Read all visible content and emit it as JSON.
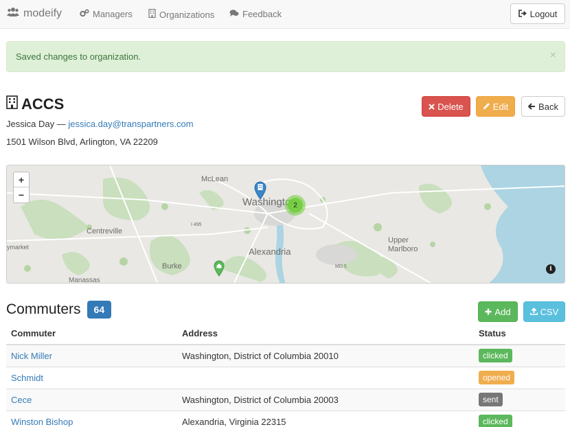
{
  "navbar": {
    "brand": "modeify",
    "items": [
      {
        "label": "Managers",
        "icon": "cogs-icon"
      },
      {
        "label": "Organizations",
        "icon": "building-icon"
      },
      {
        "label": "Feedback",
        "icon": "comments-icon"
      }
    ],
    "logout_label": "Logout"
  },
  "alert": {
    "message": "Saved changes to organization.",
    "close": "×"
  },
  "organization": {
    "name": "ACCS",
    "contact_name": "Jessica Day",
    "contact_separator": "—",
    "contact_email": "jessica.day@transpartners.com",
    "address": "1501 Wilson Blvd, Arlington, VA 22209"
  },
  "actions": {
    "delete_label": "Delete",
    "edit_label": "Edit",
    "back_label": "Back"
  },
  "map": {
    "zoom_in": "+",
    "zoom_out": "−",
    "cluster_count": "2",
    "info": "i",
    "places": {
      "mclean": "McLean",
      "washington": "Washington",
      "centreville": "Centreville",
      "alexandria": "Alexandria",
      "upper_marlboro": "Upper Marlboro",
      "burke": "Burke",
      "manassas": "Manassas",
      "market": "ymarket",
      "i495": "I 495",
      "md5": "MD 5"
    }
  },
  "commuters": {
    "title": "Commuters",
    "count": "64",
    "add_label": "Add",
    "csv_label": "CSV",
    "columns": [
      "Commuter",
      "Address",
      "Status"
    ],
    "rows": [
      {
        "name": "Nick Miller",
        "address": "Washington, District of Columbia 20010",
        "status": "clicked"
      },
      {
        "name": "Schmidt",
        "address": "",
        "status": "opened"
      },
      {
        "name": "Cece",
        "address": "Washington, District of Columbia 20003",
        "status": "sent"
      },
      {
        "name": "Winston Bishop",
        "address": "Alexandria, Virginia 22315",
        "status": "clicked"
      }
    ]
  },
  "status_colors": {
    "clicked": "#5cb85c",
    "opened": "#f0ad4e",
    "sent": "#777777"
  }
}
